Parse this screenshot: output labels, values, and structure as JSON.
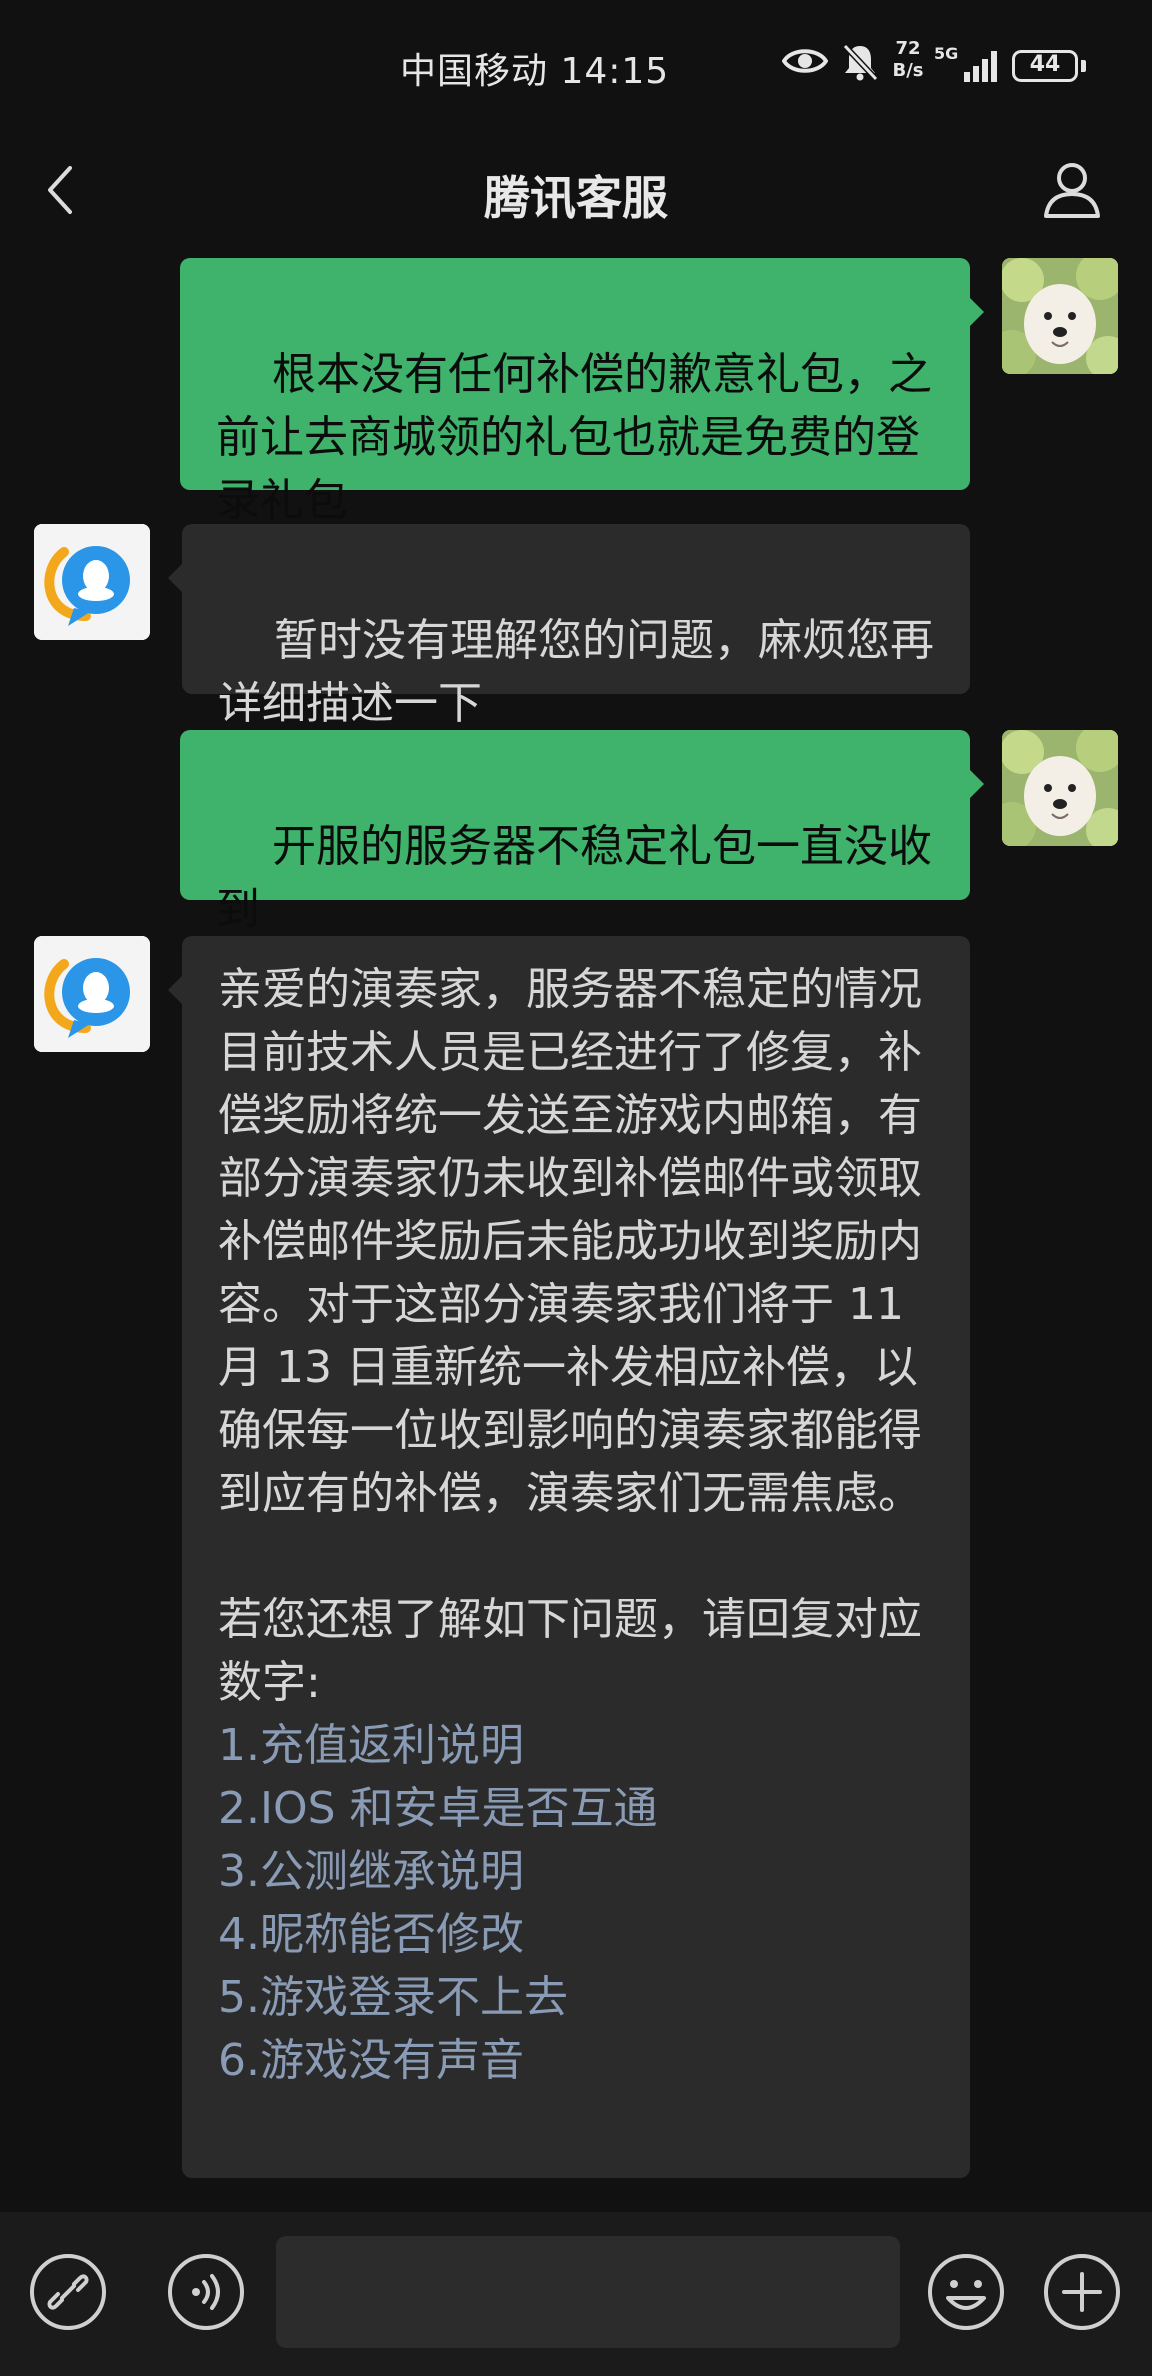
{
  "status_bar": {
    "carrier_time": "中国移动 14:15",
    "net_speed_value": "72",
    "net_speed_unit": "B/s",
    "network": "5G",
    "battery": "44"
  },
  "nav": {
    "title": "腾讯客服"
  },
  "messages": [
    {
      "sender": "user",
      "text": "根本没有任何补偿的歉意礼包，之前让去商城领的礼包也就是免费的登录礼包"
    },
    {
      "sender": "bot",
      "text": "暂时没有理解您的问题，麻烦您再详细描述一下"
    },
    {
      "sender": "user",
      "text": "开服的服务器不稳定礼包一直没收到"
    },
    {
      "sender": "bot",
      "text": "亲爱的演奏家，服务器不稳定的情况目前技术人员是已经进行了修复，补偿奖励将统一发送至游戏内邮箱，有部分演奏家仍未收到补偿邮件或领取补偿邮件奖励后未能成功收到奖励内容。对于这部分演奏家我们将于 11 月 13 日重新统一补发相应补偿，以确保每一位收到影响的演奏家都能得到应有的补偿，演奏家们无需焦虑。",
      "prompt": "若您还想了解如下问题，请回复对应数字:",
      "options": [
        "1.充值返利说明",
        "2.IOS 和安卓是否互通",
        "3.公测继承说明",
        "4.昵称能否修改",
        "5.游戏登录不上去",
        "6.游戏没有声音"
      ]
    }
  ],
  "colors": {
    "background": "#111111",
    "user_bubble": "#3fb26c",
    "bot_bubble": "#2b2b2b",
    "option_link": "#8a9bb5"
  },
  "icons": [
    "eye-icon",
    "bell-off-icon",
    "signal-icon",
    "back-icon",
    "profile-icon",
    "link-icon",
    "voice-icon",
    "emoji-icon",
    "plus-icon"
  ]
}
